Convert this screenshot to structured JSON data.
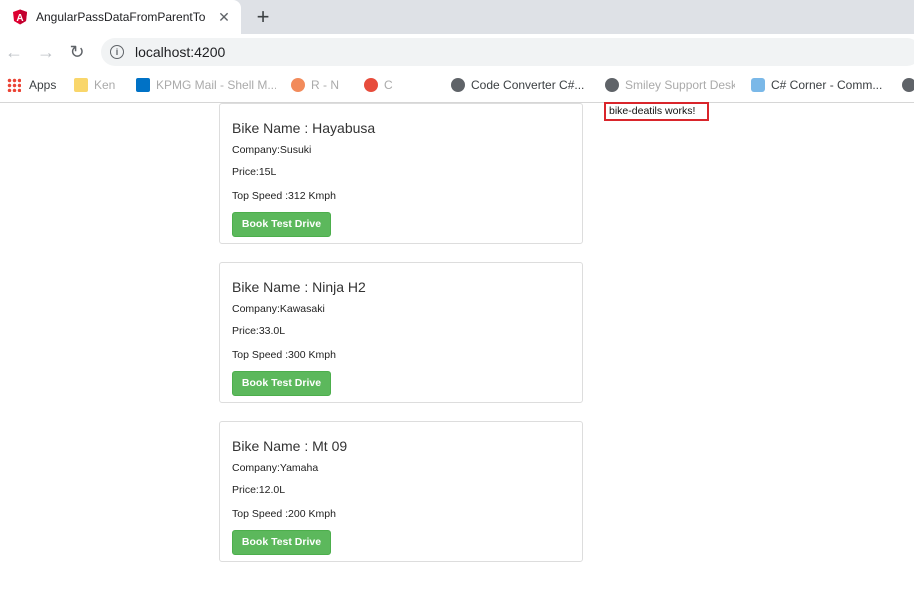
{
  "browser": {
    "tab_title": "AngularPassDataFromParentToCh",
    "url": "localhost:4200",
    "bookmarks": [
      "Apps",
      "Ken",
      "KPMG Mail - Shell M...",
      "R - N",
      "C",
      "Code Converter C#...",
      "Smiley Support Desk",
      "C# Corner - Comm...",
      ""
    ]
  },
  "bikes": [
    {
      "title": "Bike Name : Hayabusa",
      "company": "Company:Susuki",
      "price": "Price:15L",
      "speed": "Top Speed :312 Kmph",
      "button": "Book Test Drive"
    },
    {
      "title": "Bike Name : Ninja H2",
      "company": "Company:Kawasaki",
      "price": "Price:33.0L",
      "speed": "Top Speed :300 Kmph",
      "button": "Book Test Drive"
    },
    {
      "title": "Bike Name : Mt 09",
      "company": "Company:Yamaha",
      "price": "Price:12.0L",
      "speed": "Top Speed :200 Kmph",
      "button": "Book Test Drive"
    }
  ],
  "detail_box": "bike-deatils works!",
  "colors": {
    "button_green": "#5cb85c",
    "highlight_red": "#d9252b",
    "angular_red": "#dd0031"
  }
}
